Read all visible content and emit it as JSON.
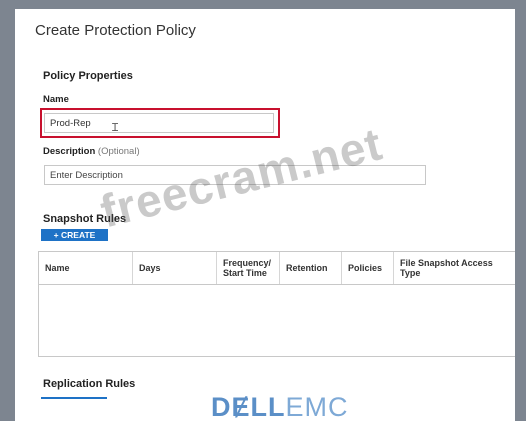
{
  "dialog": {
    "title": "Create Protection Policy"
  },
  "policy_properties": {
    "heading": "Policy Properties",
    "name_label": "Name",
    "name_value": "Prod-Rep",
    "description_label": "Description",
    "description_optional": "(Optional)",
    "description_placeholder": "Enter Description"
  },
  "snapshot_rules": {
    "heading": "Snapshot Rules",
    "create_label": "+ CREATE",
    "columns": [
      "Name",
      "Days",
      "Frequency/\nStart Time",
      "Retention",
      "Policies",
      "File Snapshot Access\nType"
    ]
  },
  "replication_rules": {
    "heading": "Replication Rules"
  },
  "watermark": "freecram.net",
  "logo": {
    "dell": "DɆLL",
    "emc": "EMC"
  }
}
